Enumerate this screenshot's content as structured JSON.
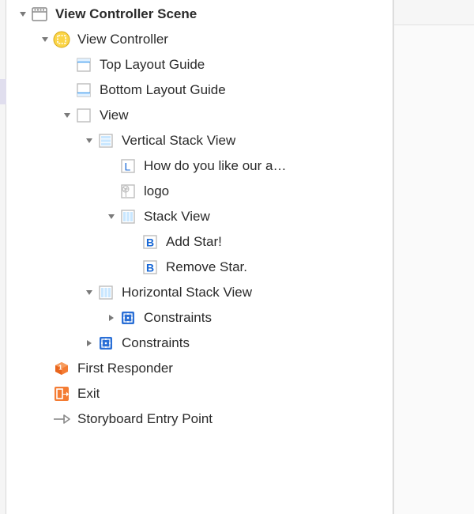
{
  "outline": {
    "scene": "View Controller Scene",
    "viewController": "View Controller",
    "topLayoutGuide": "Top Layout Guide",
    "bottomLayoutGuide": "Bottom Layout Guide",
    "view": "View",
    "verticalStack": "Vertical Stack View",
    "labelNode": "How do you like our a…",
    "imageNode": "logo",
    "stackView": "Stack View",
    "addStar": "Add Star!",
    "removeStar": "Remove Star.",
    "horizontalStack": "Horizontal Stack View",
    "constraints": "Constraints",
    "firstResponder": "First Responder",
    "exit": "Exit",
    "entryPoint": "Storyboard Entry Point"
  }
}
